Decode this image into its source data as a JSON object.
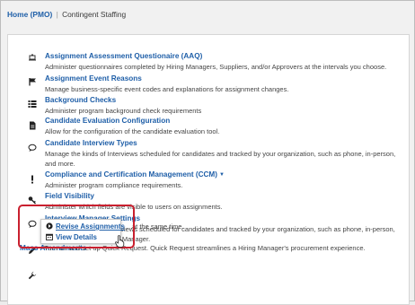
{
  "breadcrumb": {
    "home": "Home (PMO)",
    "separator": "|",
    "current": "Contingent Staffing"
  },
  "items": [
    {
      "title": "Assignment Assessment Questionaire (AAQ)",
      "desc": "Administer questionnaires completed by Hiring Managers, Suppliers, and/or Approvers at the intervals you choose.",
      "icon": "clipboard-icon"
    },
    {
      "title": "Assignment Event Reasons",
      "desc": "Manage business-specific event codes and explanations for assignment changes.",
      "icon": "flag-icon"
    },
    {
      "title": "Background Checks",
      "desc": "Administer program background check requirements",
      "icon": "list-icon"
    },
    {
      "title": "Candidate Evaluation Configuration",
      "desc": "Allow for the configuration of the candidate evaluation tool.",
      "icon": "document-icon"
    },
    {
      "title": "Candidate Interview Types",
      "desc": "Manage the kinds of Interviews scheduled for candidates and tracked by your organization, such as phone, in-person, and more.",
      "icon": "speech-bubble-icon"
    },
    {
      "title": "Compliance and Certification Management (CCM)",
      "desc": "Administer program compliance requirements.",
      "icon": "exclamation-icon"
    },
    {
      "title": "Field Visibility",
      "desc": "Administer which fields are visible to users on assignments.",
      "icon": "key-icon"
    },
    {
      "title": "Interview Manager Settings",
      "desc": "Manage the kinds of interviews scheduled for candidates and tracked by your organization, such as phone, in-person, and more using Interview Manager.",
      "icon": "speech-bubble-icon"
    }
  ],
  "mass_amendments": {
    "label": "Mass Amendments",
    "caret": "▾",
    "menu": [
      {
        "label": "Revise Assignments",
        "icon": "arrow-circle-icon"
      },
      {
        "label": "View Details",
        "icon": "calendar-icon"
      }
    ],
    "partial_desc": "at the same time."
  },
  "quick_request": {
    "desc": "Turn on and set up Quick Request. Quick Request streamlines a Hiring Manager's procurement experience."
  },
  "colors": {
    "link": "#1f5fa8",
    "highlight": "#c9202f"
  }
}
